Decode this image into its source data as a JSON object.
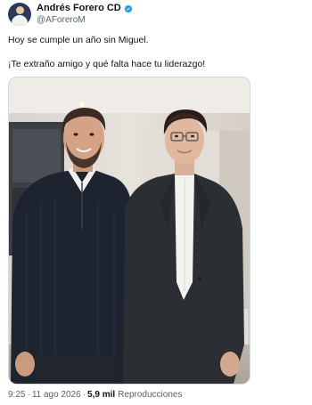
{
  "author": {
    "display_name": "Andrés Forero CD",
    "handle": "@AForeroM",
    "verified_icon": "verified-badge-icon",
    "verified_color": "#1d9bf0"
  },
  "tweet": {
    "line1": "Hoy se cumple un año sin Miguel.",
    "line2": "¡Te extraño amigo y qué falta hace tu liderazgo!"
  },
  "meta": {
    "time": "9:25",
    "separator": "·",
    "date": "11 ago 2026",
    "views_count": "5,9 mil",
    "views_label": "Reproducciones"
  },
  "colors": {
    "text_primary": "#0f1419",
    "text_secondary": "#536471",
    "border": "#cfd9de"
  }
}
